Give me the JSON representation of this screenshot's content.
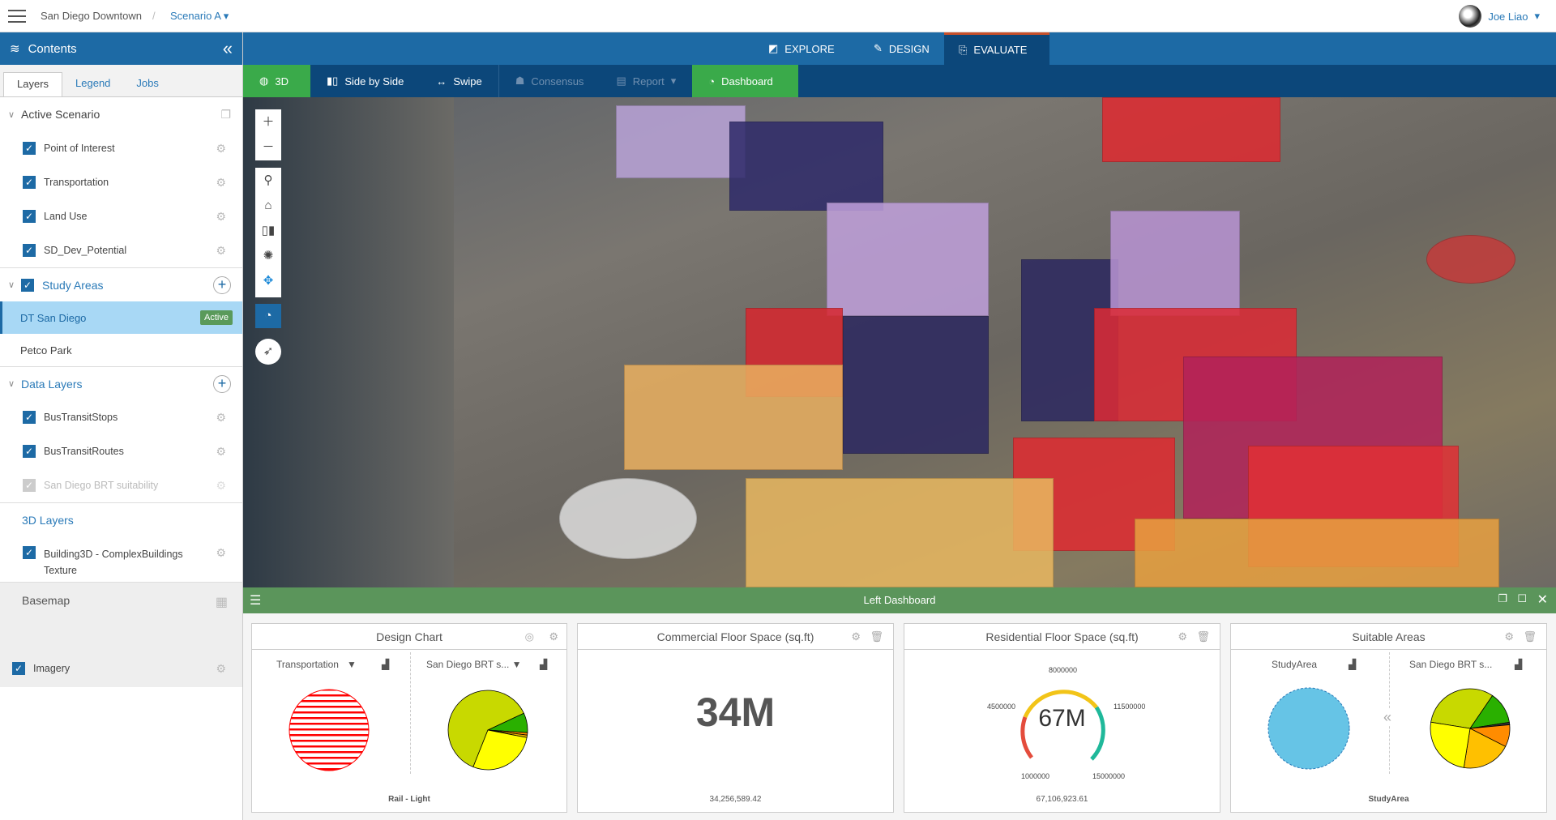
{
  "topbar": {
    "project": "San Diego Downtown",
    "separator": "/",
    "scenario": "Scenario A",
    "user": "Joe Liao"
  },
  "sidebar": {
    "title": "Contents",
    "tabs": [
      "Layers",
      "Legend",
      "Jobs"
    ],
    "active_scenario": {
      "label": "Active Scenario",
      "layers": [
        "Point of Interest",
        "Transportation",
        "Land Use",
        "SD_Dev_Potential"
      ]
    },
    "study_areas": {
      "label": "Study Areas",
      "items": [
        {
          "name": "DT San Diego",
          "badge": "Active"
        },
        {
          "name": "Petco Park"
        }
      ]
    },
    "data_layers": {
      "label": "Data Layers",
      "layers": [
        "BusTransitStops",
        "BusTransitRoutes",
        "San Diego BRT suitability"
      ]
    },
    "layers_3d": {
      "label": "3D Layers",
      "layers": [
        "Building3D - ComplexBuildings Texture"
      ]
    },
    "basemap": {
      "label": "Basemap",
      "layers": [
        "Imagery"
      ]
    }
  },
  "modes": [
    "EXPLORE",
    "DESIGN",
    "EVALUATE"
  ],
  "toolbar": {
    "view3d": "3D",
    "side": "Side by Side",
    "swipe": "Swipe",
    "consensus": "Consensus",
    "report": "Report",
    "dashboard": "Dashboard"
  },
  "colors": {
    "primary": "#1d6aa5",
    "dark": "#0c477a",
    "green": "#3aaa4a",
    "dash": "#5b955b"
  },
  "dashboard": {
    "title": "Left Dashboard",
    "design_chart": {
      "title": "Design Chart",
      "left_select": "Transportation",
      "right_select": "San Diego BRT s...",
      "footer": "Rail - Light",
      "pie": [
        {
          "color": "#c8d900",
          "value": 0.62
        },
        {
          "color": "#2ab000",
          "value": 0.08
        },
        {
          "color": "#ff8c00",
          "value": 0.01
        },
        {
          "color": "#e0b000",
          "value": 0.01
        },
        {
          "color": "#ffff00",
          "value": 0.28
        }
      ]
    },
    "commercial": {
      "title": "Commercial Floor Space (sq.ft)",
      "value": "34M",
      "exact": "34,256,589.42"
    },
    "residential": {
      "title": "Residential Floor Space (sq.ft)",
      "value": "67M",
      "exact": "67,106,923.61",
      "ticks": [
        "1000000",
        "4500000",
        "8000000",
        "11500000",
        "15000000"
      ]
    },
    "suitable": {
      "title": "Suitable Areas",
      "left_select": "StudyArea",
      "right_select": "San Diego BRT s...",
      "footer": "StudyArea",
      "pie": [
        {
          "color": "#c8d900",
          "value": 0.32
        },
        {
          "color": "#2ab000",
          "value": 0.13
        },
        {
          "color": "#333333",
          "value": 0.01
        },
        {
          "color": "#ff8c00",
          "value": 0.09
        },
        {
          "color": "#ffc000",
          "value": 0.2
        },
        {
          "color": "#ffff00",
          "value": 0.25
        }
      ]
    }
  }
}
